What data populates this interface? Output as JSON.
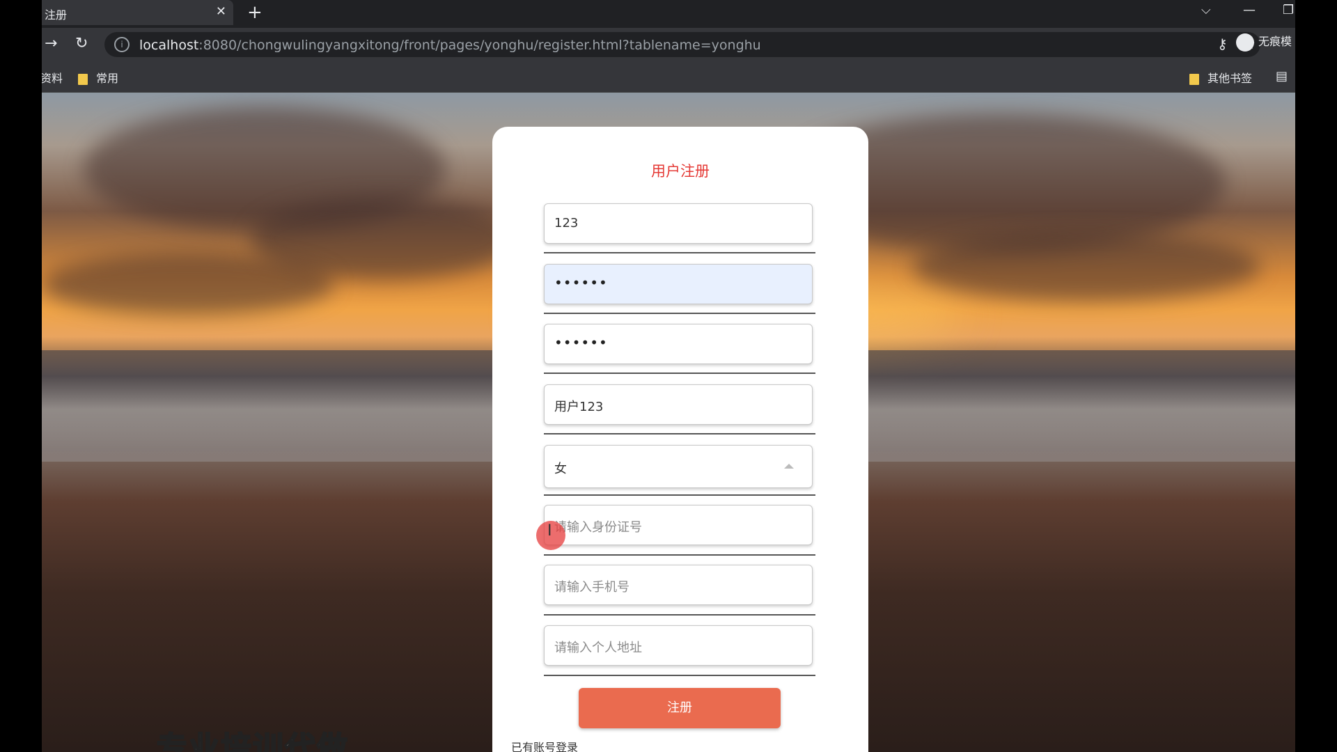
{
  "browser": {
    "tab_title": "注册",
    "tab_close": "✕",
    "new_tab": "+",
    "url_host": "localhost",
    "url_rest": ":8080/chongwulingyangxitong/front/pages/yonghu/register.html?tablename=yonghu",
    "profile_label": "无痕模",
    "icons": [
      "back-arrow-icon",
      "reload-icon",
      "info-icon",
      "key-icon",
      "star-icon",
      "chevron-down-icon",
      "minimize-icon",
      "restore-icon",
      "reading-list-icon"
    ]
  },
  "bookmarks": {
    "left_partial": "资料",
    "common": "常用",
    "others": "其他书签"
  },
  "form": {
    "title": "用户注册",
    "username_value": "123",
    "password_value": "••••••",
    "confirm_password_value": "••••••",
    "name_value": "用户123",
    "gender_value": "女",
    "id_placeholder": "请输入身份证号",
    "phone_placeholder": "请输入手机号",
    "address_placeholder": "请输入个人地址",
    "submit_label": "注册",
    "login_link": "已有账号登录"
  },
  "overlay": {
    "subtitle_text": "专业培训代做"
  },
  "colors": {
    "title": "#e53935",
    "submit": "#ea6b4f",
    "focused_field": "#e8f0fe"
  }
}
